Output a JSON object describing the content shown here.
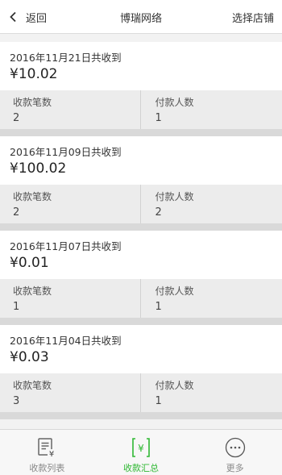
{
  "header": {
    "back_label": "返回",
    "title": "博瑞网络",
    "choose_store_label": "选择店铺"
  },
  "records": [
    {
      "date_line": "2016年11月21日共收到",
      "amount": "¥10.02",
      "count_label": "收款笔数",
      "count_value": "2",
      "payers_label": "付款人数",
      "payers_value": "1"
    },
    {
      "date_line": "2016年11月09日共收到",
      "amount": "¥100.02",
      "count_label": "收款笔数",
      "count_value": "2",
      "payers_label": "付款人数",
      "payers_value": "2"
    },
    {
      "date_line": "2016年11月07日共收到",
      "amount": "¥0.01",
      "count_label": "收款笔数",
      "count_value": "1",
      "payers_label": "付款人数",
      "payers_value": "1"
    },
    {
      "date_line": "2016年11月04日共收到",
      "amount": "¥0.03",
      "count_label": "收款笔数",
      "count_value": "3",
      "payers_label": "付款人数",
      "payers_value": "1"
    }
  ],
  "tabbar": {
    "tabs": [
      {
        "label": "收款列表",
        "icon": "receipt-list-icon",
        "active": false
      },
      {
        "label": "收款汇总",
        "icon": "summary-yuan-icon",
        "active": true
      },
      {
        "label": "更多",
        "icon": "more-dots-icon",
        "active": false
      }
    ]
  },
  "colors": {
    "active_tab": "#2fb833",
    "inactive_tab": "#888888",
    "stats_bg": "#ececec",
    "separator": "#d9d9d9"
  }
}
